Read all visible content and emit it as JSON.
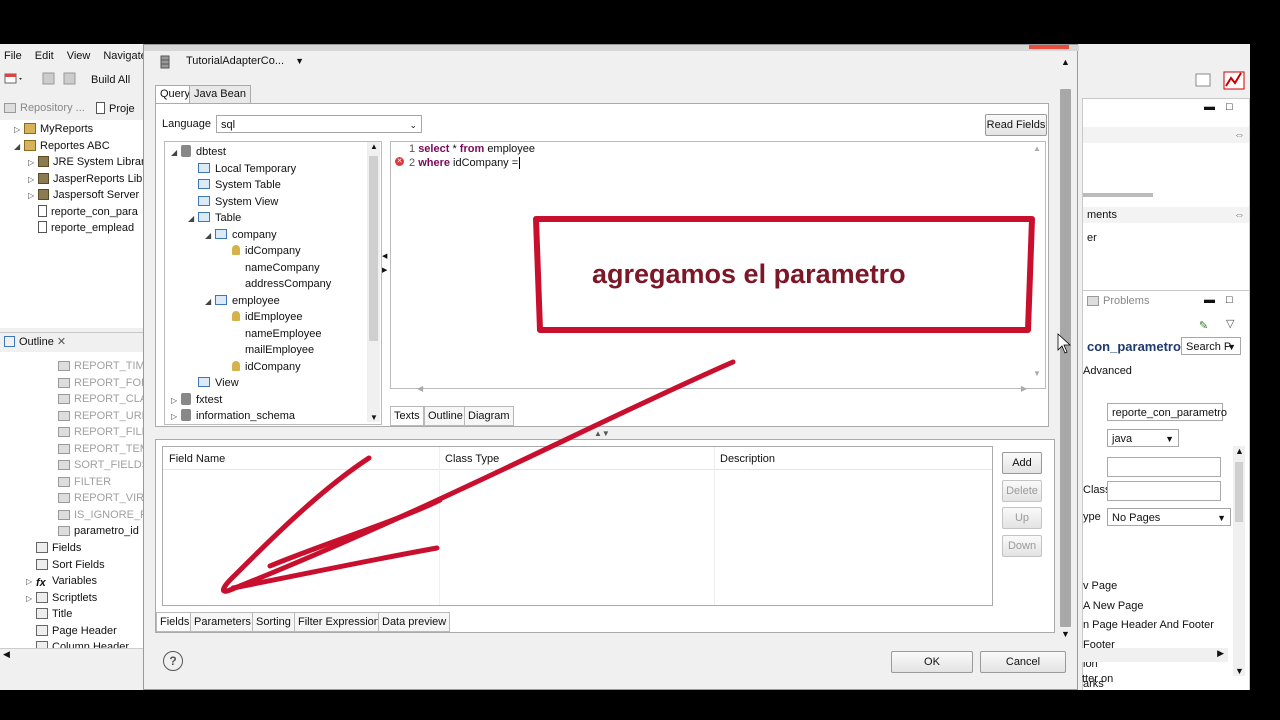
{
  "menu": [
    "File",
    "Edit",
    "View",
    "Navigate"
  ],
  "toolbar": {
    "build_all": "Build All"
  },
  "left_tabs": {
    "repository": "Repository ...",
    "project": "Proje"
  },
  "project_tree": [
    {
      "label": "MyReports",
      "type": "proj",
      "indent": 0
    },
    {
      "label": "Reportes ABC",
      "type": "proj",
      "indent": 0
    },
    {
      "label": "JRE System Librar",
      "type": "lib",
      "indent": 1
    },
    {
      "label": "JasperReports Lib",
      "type": "lib",
      "indent": 1
    },
    {
      "label": "Jaspersoft Server",
      "type": "lib",
      "indent": 1
    },
    {
      "label": "reporte_con_para",
      "type": "file",
      "indent": 1
    },
    {
      "label": "reporte_emplead",
      "type": "file",
      "indent": 1
    }
  ],
  "outline": {
    "title": "Outline",
    "items": [
      {
        "label": "REPORT_TIME",
        "grey": true
      },
      {
        "label": "REPORT_FOR",
        "grey": true
      },
      {
        "label": "REPORT_CLA",
        "grey": true
      },
      {
        "label": "REPORT_URL",
        "grey": true
      },
      {
        "label": "REPORT_FILE",
        "grey": true
      },
      {
        "label": "REPORT_TEM",
        "grey": true
      },
      {
        "label": "SORT_FIELDS",
        "grey": true
      },
      {
        "label": "FILTER",
        "grey": true
      },
      {
        "label": "REPORT_VIRT",
        "grey": true
      },
      {
        "label": "IS_IGNORE_P",
        "grey": true
      },
      {
        "label": "parametro_id",
        "grey": false
      }
    ],
    "sections": [
      "Fields",
      "Sort Fields",
      "Variables",
      "Scriptlets",
      "Title",
      "Page Header",
      "Column Header"
    ]
  },
  "dialog": {
    "adapter": "TutorialAdapterCo...",
    "tabs": [
      "Query",
      "Java Bean"
    ],
    "language_label": "Language",
    "language_value": "sql",
    "read_fields": "Read Fields",
    "schema_tree": [
      {
        "label": "dbtest",
        "icon": "db",
        "indent": 0,
        "tw": "◢"
      },
      {
        "label": "Local Temporary",
        "icon": "tbl",
        "indent": 1,
        "tw": ""
      },
      {
        "label": "System Table",
        "icon": "tbl",
        "indent": 1,
        "tw": ""
      },
      {
        "label": "System View",
        "icon": "tbl",
        "indent": 1,
        "tw": ""
      },
      {
        "label": "Table",
        "icon": "tbl",
        "indent": 1,
        "tw": "◢"
      },
      {
        "label": "company",
        "icon": "tbl",
        "indent": 2,
        "tw": "◢"
      },
      {
        "label": "idCompany",
        "icon": "key",
        "indent": 3,
        "tw": ""
      },
      {
        "label": "nameCompany",
        "icon": "none",
        "indent": 3,
        "tw": ""
      },
      {
        "label": "addressCompany",
        "icon": "none",
        "indent": 3,
        "tw": ""
      },
      {
        "label": "employee",
        "icon": "tbl",
        "indent": 2,
        "tw": "◢"
      },
      {
        "label": "idEmployee",
        "icon": "key",
        "indent": 3,
        "tw": ""
      },
      {
        "label": "nameEmployee",
        "icon": "none",
        "indent": 3,
        "tw": ""
      },
      {
        "label": "mailEmployee",
        "icon": "none",
        "indent": 3,
        "tw": ""
      },
      {
        "label": "idCompany",
        "icon": "key",
        "indent": 3,
        "tw": ""
      },
      {
        "label": "View",
        "icon": "tbl",
        "indent": 1,
        "tw": ""
      },
      {
        "label": "fxtest",
        "icon": "db",
        "indent": 0,
        "tw": "▷"
      },
      {
        "label": "information_schema",
        "icon": "db",
        "indent": 0,
        "tw": "▷"
      }
    ],
    "sql": {
      "line1_num": "1",
      "line1_kw1": "select",
      "line1_mid": "*",
      "line1_kw2": "from",
      "line1_rest": "employee",
      "line2_num": "2",
      "line2_kw": "where",
      "line2_rest": "idCompany ="
    },
    "editor_tabs": [
      "Texts",
      "Outline",
      "Diagram"
    ],
    "fields_columns": [
      "Field Name",
      "Class Type",
      "Description"
    ],
    "side_buttons": {
      "add": "Add",
      "delete": "Delete",
      "up": "Up",
      "down": "Down"
    },
    "bottom_tabs": [
      "Fields",
      "Parameters",
      "Sorting",
      "Filter Expression",
      "Data preview"
    ],
    "ok": "OK",
    "cancel": "Cancel",
    "help_icon": "help-icon"
  },
  "annotation": {
    "text": "agregamos el parametro",
    "color": "#c8102e"
  },
  "right_panel": {
    "ments": "ments",
    "er": "er",
    "problems": "Problems",
    "title": "con_parametro",
    "search": "Search P",
    "advanced": "Advanced",
    "name_value": "reporte_con_parametro",
    "lang_value": "java",
    "class_label": "Class",
    "type_label": "ype",
    "type_value": "No Pages",
    "rows": [
      "v Page",
      "A New Page",
      "n Page Header And Footer",
      "Footer",
      "ion",
      "arks"
    ],
    "footer": "tter on"
  }
}
